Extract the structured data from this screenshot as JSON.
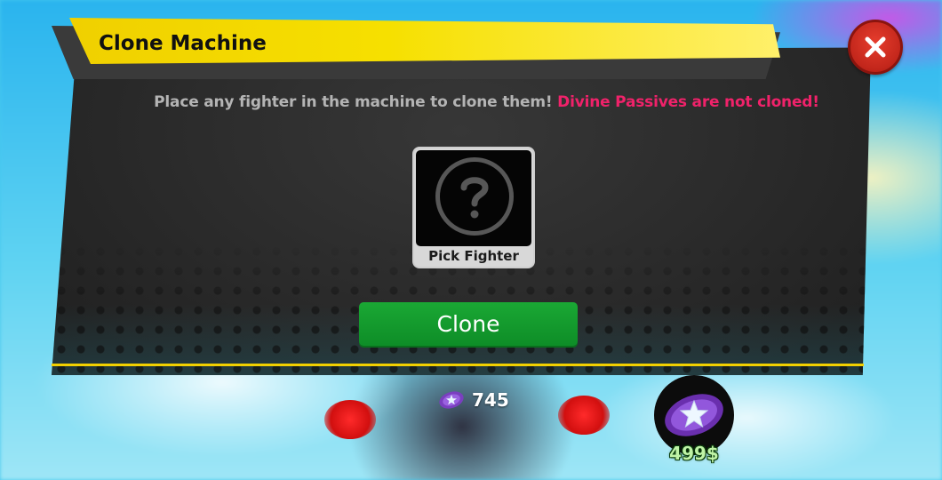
{
  "window": {
    "title": "Clone Machine"
  },
  "message": {
    "main": "Place any fighter in the machine to clone them!",
    "warning": "Divine Passives are not cloned!"
  },
  "slot": {
    "label": "Pick Fighter",
    "icon": "question-mark-icon"
  },
  "actions": {
    "clone_label": "Clone",
    "close_icon": "close-icon"
  },
  "currency": {
    "icon": "purple-star-coin-icon",
    "amount": "745"
  },
  "shop": {
    "icon": "purple-star-coin-icon",
    "price": "499$"
  },
  "colors": {
    "banner": "#f0d000",
    "warning": "#f0226a",
    "clone_button": "#1aa834",
    "close_button": "#d83326",
    "price_text": "#bff3a6"
  }
}
